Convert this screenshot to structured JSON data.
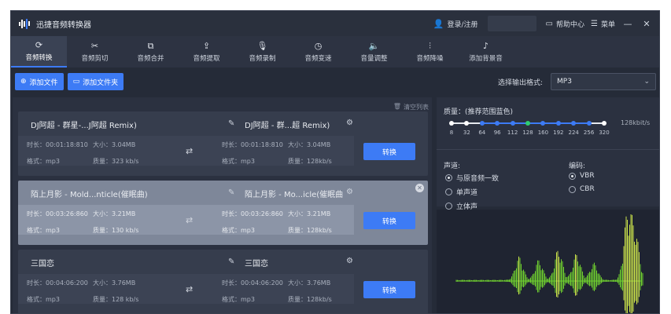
{
  "app": {
    "title": "迅捷音频转换器"
  },
  "titlebar": {
    "login_label": "登录/注册",
    "help_label": "帮助中心",
    "menu_label": "菜单",
    "minimize": "—",
    "close": "✕"
  },
  "toolbar": {
    "tools": [
      {
        "label": "音频转换",
        "icon": "refresh-icon",
        "glyph": "⟳"
      },
      {
        "label": "音频剪切",
        "icon": "scissors-icon",
        "glyph": "✂"
      },
      {
        "label": "音频合并",
        "icon": "merge-icon",
        "glyph": "⧉"
      },
      {
        "label": "音频提取",
        "icon": "extract-icon",
        "glyph": "⇪"
      },
      {
        "label": "音频录制",
        "icon": "microphone-icon",
        "glyph": "🎙"
      },
      {
        "label": "音频变速",
        "icon": "speed-icon",
        "glyph": "◷"
      },
      {
        "label": "音量调整",
        "icon": "volume-icon",
        "glyph": "🔈"
      },
      {
        "label": "音频降噪",
        "icon": "noise-icon",
        "glyph": "⫶"
      },
      {
        "label": "添加背景音",
        "icon": "music-icon",
        "glyph": "♪"
      }
    ]
  },
  "actions": {
    "add_file": "添加文件",
    "add_folder": "添加文件夹",
    "output_format_label": "选择输出格式:",
    "output_format_value": "MP3"
  },
  "list": {
    "clear_label": "清空列表",
    "files": [
      {
        "name": "DJ阿超 - 群星-...J阿超 Remix)",
        "out_name": "DJ阿超 - 群...超 Remix)",
        "duration": "时长：00:01:18:810",
        "size": "大小：3.04MB",
        "format": "格式：mp3",
        "quality": "质量：323 kb/s",
        "out_duration": "时长：00:01:18:810",
        "out_size": "大小：3.04MB",
        "out_format": "格式：mp3",
        "out_quality": "质量：128kb/s",
        "convert": "转换"
      },
      {
        "name": "陌上月影 - Mold...nticle(催眠曲)",
        "out_name": "陌上月影 - Mo...icle(催眠曲",
        "duration": "时长：00:03:26:860",
        "size": "大小：3.21MB",
        "format": "格式：mp3",
        "quality": "质量：130 kb/s",
        "out_duration": "时长：00:03:26:860",
        "out_size": "大小：3.21MB",
        "out_format": "格式：mp3",
        "out_quality": "质量：128kb/s",
        "convert": "转换"
      },
      {
        "name": "三国恋",
        "out_name": "三国恋",
        "duration": "时长：00:04:06:200",
        "size": "大小：3.76MB",
        "format": "格式：mp3",
        "quality": "质量：128 kb/s",
        "out_duration": "时长：00:04:06:200",
        "out_size": "大小：3.76MB",
        "out_format": "格式：mp3",
        "out_quality": "质量：128kb/s",
        "convert": "转换"
      }
    ]
  },
  "settings": {
    "quality_label": "质量：(推荐范围蓝色)",
    "quality_ticks": [
      "8",
      "32",
      "64",
      "96",
      "112",
      "128",
      "160",
      "192",
      "224",
      "256",
      "320"
    ],
    "quality_selected_index": 5,
    "quality_value": "128kbit/s",
    "channel_label": "声道:",
    "channels": [
      "与原音频一致",
      "单声道",
      "立体声"
    ],
    "channel_selected": 0,
    "encoding_label": "编码:",
    "encodings": [
      "VBR",
      "CBR"
    ],
    "encoding_selected": 0
  },
  "colors": {
    "accent": "#3d7bf5",
    "wave_green": "#6fcf2f",
    "wave_yellow": "#c8e04a"
  }
}
